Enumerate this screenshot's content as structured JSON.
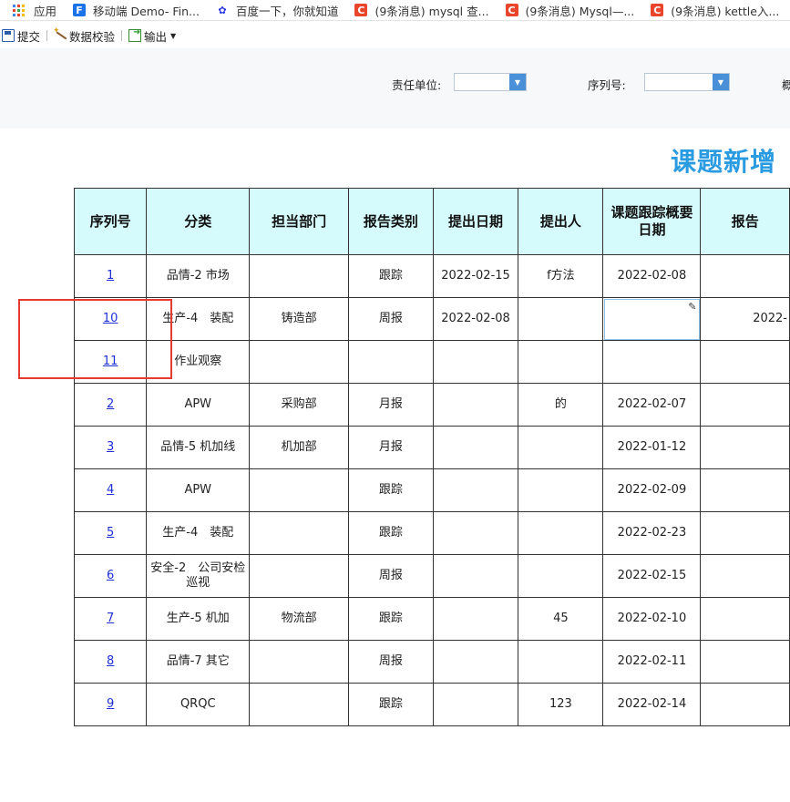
{
  "bookmarks": [
    {
      "label": "应用",
      "icon": "apps-grid-icon"
    },
    {
      "label": "移动端 Demo- Fin...",
      "icon": "fine-icon"
    },
    {
      "label": "百度一下，你就知道",
      "icon": "baidu-paw-icon"
    },
    {
      "label": "(9条消息) mysql 查...",
      "icon": "csdn-icon"
    },
    {
      "label": "(9条消息) Mysql—...",
      "icon": "csdn-icon"
    },
    {
      "label": "(9条消息) kettle入...",
      "icon": "csdn-icon"
    }
  ],
  "toolbar": {
    "submit_label": "提交",
    "validate_label": "数据校验",
    "export_label": "输出"
  },
  "filters": {
    "responsible_unit_label": "责任单位:",
    "serial_label": "序列号:",
    "overflow_label": "概"
  },
  "report": {
    "title": "课题新增"
  },
  "table": {
    "headers": [
      "序列号",
      "分类",
      "担当部门",
      "报告类别",
      "提出日期",
      "提出人",
      "课题跟踪概要日期",
      "报告"
    ],
    "rows": [
      [
        "1",
        "品情-2 市场",
        "",
        "跟踪",
        "2022-02-15",
        "f方法",
        "2022-02-08",
        ""
      ],
      [
        "10",
        "生产-4　装配",
        "铸造部",
        "周报",
        "2022-02-08",
        "",
        "",
        "2022-"
      ],
      [
        "11",
        "作业观察",
        "",
        "",
        "",
        "",
        "",
        ""
      ],
      [
        "2",
        "APW",
        "采购部",
        "月报",
        "",
        "的",
        "2022-02-07",
        ""
      ],
      [
        "3",
        "品情-5 机加线",
        "机加部",
        "月报",
        "",
        "",
        "2022-01-12",
        ""
      ],
      [
        "4",
        "APW",
        "",
        "跟踪",
        "",
        "",
        "2022-02-09",
        ""
      ],
      [
        "5",
        "生产-4　装配",
        "",
        "跟踪",
        "",
        "",
        "2022-02-23",
        ""
      ],
      [
        "6",
        "安全-2　公司安检巡视",
        "",
        "周报",
        "",
        "",
        "2022-02-15",
        ""
      ],
      [
        "7",
        "生产-5 机加",
        "物流部",
        "跟踪",
        "",
        "45",
        "2022-02-10",
        ""
      ],
      [
        "8",
        "品情-7 其它",
        "",
        "周报",
        "",
        "",
        "2022-02-11",
        ""
      ],
      [
        "9",
        "QRQC",
        "",
        "跟踪",
        "",
        "123",
        "2022-02-14",
        ""
      ]
    ]
  },
  "colors": {
    "header_bg": "#d6fbfd",
    "title": "#2a9be0",
    "link": "#1f2fd6",
    "highlight": "#e53a2f"
  }
}
